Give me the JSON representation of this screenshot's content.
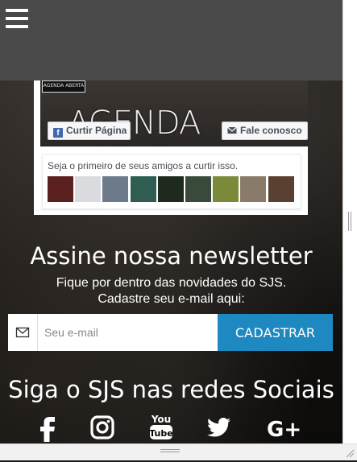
{
  "header": {
    "menu_icon": "hamburger-icon",
    "bg_color": "#4a4a4a"
  },
  "facebook_plugin": {
    "cover_logo_text": "AGENDA ABERTA",
    "cover_title": "AGENDA ABERTA",
    "like_button": "Curtir Página",
    "contact_button": "Fale conosco",
    "friends_text": "Seja o primeiro de seus amigos a curtir isso.",
    "faces": [
      {
        "name": "face-1",
        "color": "#5a1f1f"
      },
      {
        "name": "face-2",
        "color": "#d9dbdf"
      },
      {
        "name": "face-3",
        "color": "#6c7a8a"
      },
      {
        "name": "face-4",
        "color": "#2f5d52"
      },
      {
        "name": "face-5",
        "color": "#1f2a1f"
      },
      {
        "name": "face-6",
        "color": "#3a4a3a"
      },
      {
        "name": "face-7",
        "color": "#7b8a3a"
      },
      {
        "name": "face-8",
        "color": "#8a7a6a"
      },
      {
        "name": "face-9",
        "color": "#5a4030"
      }
    ]
  },
  "newsletter": {
    "title": "Assine nossa newsletter",
    "subtitle_line1": "Fique por dentro das novidades do SJS.",
    "subtitle_line2": "Cadastre seu e-mail aqui:",
    "email_placeholder": "Seu e-mail",
    "submit_label": "CADASTRAR",
    "accent_color": "#1e88c0"
  },
  "social": {
    "title": "Siga o SJS nas redes Sociais",
    "icons": [
      "facebook-icon",
      "instagram-icon",
      "youtube-icon",
      "twitter-icon",
      "google-plus-icon"
    ],
    "youtube_text_top": "You",
    "youtube_text_bottom": "Tube",
    "google_plus_text": "G+"
  }
}
